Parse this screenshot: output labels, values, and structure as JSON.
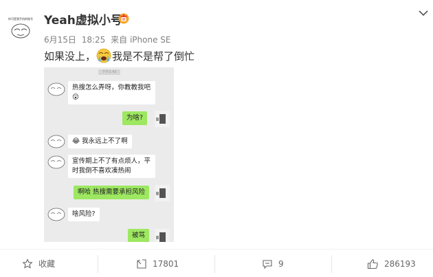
{
  "post": {
    "avatar_caption": "你可是我手机的账号",
    "username": "Yeah虚拟小号",
    "date": "6月15日",
    "time": "18:25",
    "source": "来自 iPhone SE",
    "text_before": "如果没上，",
    "text_after": "我是不是帮了倒忙"
  },
  "image": {
    "watermark": "下午1:43",
    "messages": [
      {
        "side": "left",
        "text_l1": "热搜怎么弄呀，你教教我吧",
        "text_l2": "😲"
      },
      {
        "side": "right",
        "text_l1": "为啥?"
      },
      {
        "side": "left",
        "text_l1": "😂 我永远上不了啊"
      },
      {
        "side": "left",
        "text_l1": "宣传期上不了有点烦人，平",
        "text_l2": "时我倒不喜欢凑热闹"
      },
      {
        "side": "right",
        "text_l1": "啊哈 热搜需要承担风险"
      },
      {
        "side": "left",
        "text_l1": "啥风险?"
      },
      {
        "side": "right",
        "text_l1": "被骂"
      }
    ]
  },
  "actions": {
    "favorite_label": "收藏",
    "repost_count": "17801",
    "comment_count": "9",
    "like_count": "286193"
  },
  "colors": {
    "bubble_green": "#9de761",
    "badge_orange": "#f5a623",
    "text_gray": "#808080"
  }
}
